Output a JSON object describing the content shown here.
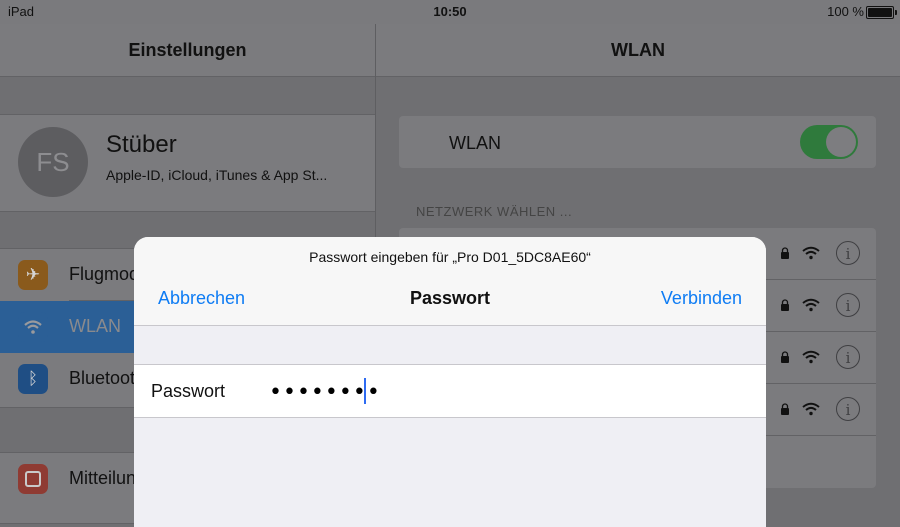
{
  "status_bar": {
    "device": "iPad",
    "time": "10:50",
    "battery": "100 %"
  },
  "left": {
    "title": "Einstellungen",
    "profile": {
      "initials": "FS",
      "name": "Stüber",
      "subtitle": "Apple-ID, iCloud, iTunes & App St..."
    },
    "items": [
      {
        "label": "Flugmodus",
        "icon": "airplane-icon",
        "color": "#f0a030"
      },
      {
        "label": "WLAN",
        "icon": "wifi-icon",
        "color": "#2f86f0",
        "selected": true
      },
      {
        "label": "Bluetooth",
        "icon": "bluetooth-icon",
        "color": "#2f86f0"
      },
      {
        "label": "Mitteilungen",
        "icon": "notifications-icon",
        "color": "#e74c3c"
      }
    ]
  },
  "right": {
    "title": "WLAN",
    "wlan_label": "WLAN",
    "wlan_enabled": true,
    "section_title": "NETZWERK WÄHLEN ..."
  },
  "dialog": {
    "prompt": "Passwort eingeben für „Pro D01_5DC8AE60“",
    "cancel": "Abbrechen",
    "title": "Passwort",
    "connect": "Verbinden",
    "password_label": "Passwort",
    "password_value": "••••••••"
  },
  "colors": {
    "accent": "#0e7cf4",
    "toggle_on": "#4cd964"
  }
}
